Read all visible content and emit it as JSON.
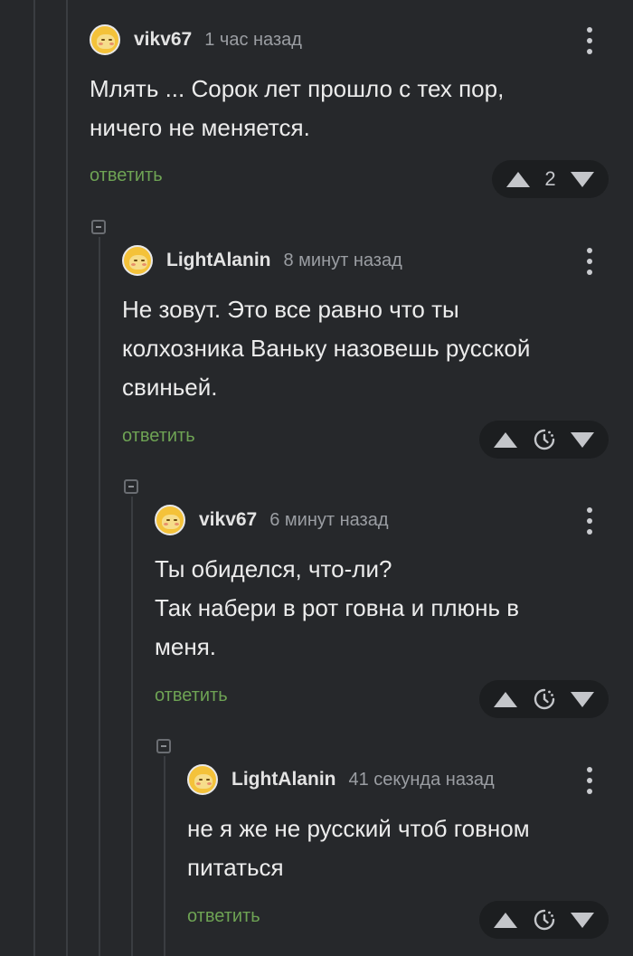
{
  "comments": [
    {
      "username": "vikv67",
      "time": "1 час назад",
      "text": "Млять ... Сорок лет прошло с тех пор,\nничего не меняется.",
      "reply_label": "ответить",
      "score": "2"
    },
    {
      "username": "LightAlanin",
      "time": "8 минут назад",
      "text": "Не зовут. Это все равно что ты\nколхозника Ваньку назовешь русской\nсвиньей.",
      "reply_label": "ответить",
      "score_icon": "clock-pending-icon"
    },
    {
      "username": "vikv67",
      "time": "6 минут назад",
      "text": "Ты обиделся, что-ли?\nТак набери в рот говна и плюнь в\nменя.",
      "reply_label": "ответить",
      "score_icon": "clock-pending-icon"
    },
    {
      "username": "LightAlanin",
      "time": "41 секунда назад",
      "text": "не я же не русский чтоб говном\nпитаться",
      "reply_label": "ответить",
      "score_icon": "clock-pending-icon"
    }
  ],
  "colors": {
    "background": "#26282b",
    "reply_link": "#6ea354",
    "vote_pill": "#1c1e20",
    "avatar": "#f4c23a"
  }
}
